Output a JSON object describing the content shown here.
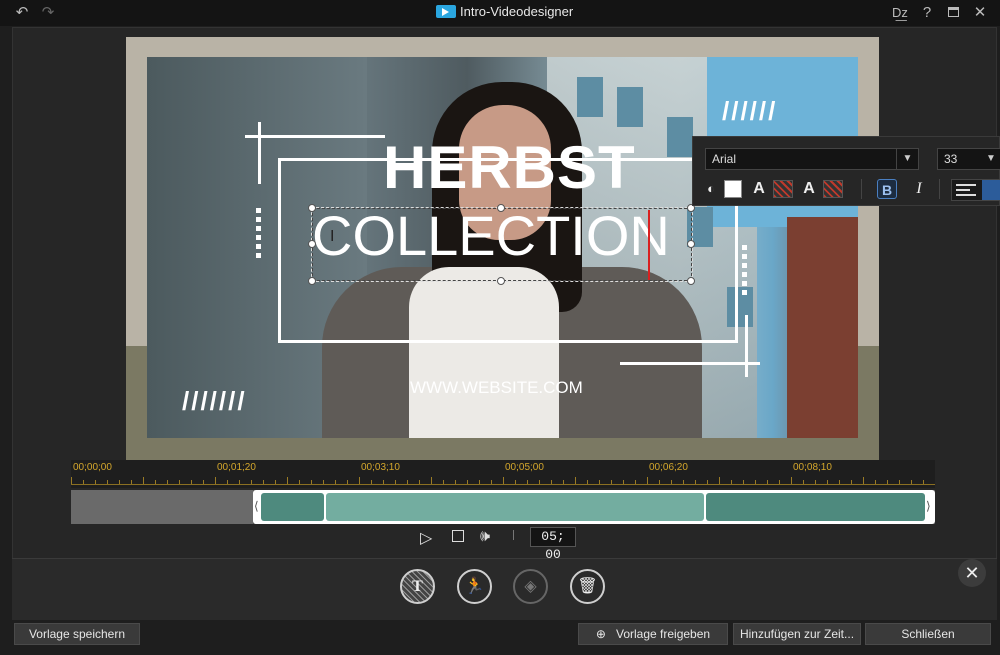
{
  "window": {
    "title": "Intro-Videodesigner",
    "undo_icon": "undo-icon",
    "redo_icon": "redo-icon",
    "controls": [
      "text-direction-icon",
      "help-icon",
      "maximize-icon",
      "close-icon"
    ],
    "help_glyph": "?"
  },
  "canvas": {
    "title_line1": "HERBST",
    "title_line2": "COLLECTION",
    "website": "WWW.WEBSITE.COM",
    "slashes_top": "//////",
    "slashes_bottom": "///////",
    "accent_colors": {
      "caret": "#d92020",
      "background_frame": "#b9b3a6",
      "background_lower": "#7b7963"
    }
  },
  "format_toolbar": {
    "font": "Arial",
    "size": "33",
    "bold_label": "B",
    "italic_label": "I",
    "text_glyph": "A",
    "fill_color": "#ffffff",
    "bold_active": true,
    "alignment": "center"
  },
  "timeline": {
    "ticks": [
      "00;00;00",
      "00;01;20",
      "00;03;10",
      "00;05;00",
      "00;06;20",
      "00;08;10"
    ],
    "timecode": "05; 00",
    "clip_colors": {
      "dark": "#4e8a7e",
      "light": "#73ada0"
    }
  },
  "tools": [
    {
      "name": "text-tool",
      "icon": "text-icon",
      "active": true
    },
    {
      "name": "motion-tool",
      "icon": "running-figure-icon",
      "active": false
    },
    {
      "name": "layers-tool",
      "icon": "layers-icon",
      "disabled": true
    },
    {
      "name": "delete-tool",
      "icon": "trash-icon",
      "active": false
    }
  ],
  "footer": {
    "save_template": "Vorlage speichern",
    "share_template": "Vorlage freigeben",
    "add_to_timeline": "Hinzufügen zur Zeit...",
    "close": "Schließen"
  }
}
